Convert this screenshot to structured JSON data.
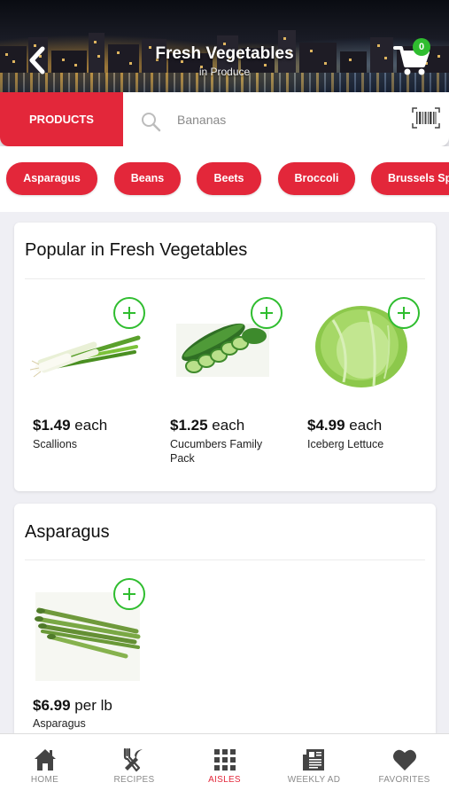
{
  "header": {
    "title": "Fresh Vegetables",
    "subtitle": "in Produce",
    "cart_count": "0"
  },
  "search": {
    "tab_label": "PRODUCTS",
    "placeholder": "Bananas"
  },
  "chips": [
    "Asparagus",
    "Beans",
    "Beets",
    "Broccoli",
    "Brussels Sprouts"
  ],
  "popular": {
    "title": "Popular in Fresh Vegetables",
    "items": [
      {
        "price": "$1.49",
        "unit": "each",
        "name": "Scallions"
      },
      {
        "price": "$1.25",
        "unit": "each",
        "name": "Cucumbers Family Pack"
      },
      {
        "price": "$4.99",
        "unit": "each",
        "name": "Iceberg Lettuce"
      }
    ]
  },
  "asparagus": {
    "title": "Asparagus",
    "items": [
      {
        "price": "$6.99",
        "unit": "per lb",
        "name": "Asparagus"
      }
    ]
  },
  "tabs": [
    {
      "label": "HOME",
      "icon": "home-icon"
    },
    {
      "label": "RECIPES",
      "icon": "recipes-icon"
    },
    {
      "label": "AISLES",
      "icon": "aisles-icon"
    },
    {
      "label": "WEEKLY AD",
      "icon": "weekly-ad-icon"
    },
    {
      "label": "FAVORITES",
      "icon": "heart-icon"
    }
  ],
  "colors": {
    "accent": "#e3273a",
    "add_green": "#2fbd2f",
    "tab_inactive": "#8a8a8a"
  }
}
